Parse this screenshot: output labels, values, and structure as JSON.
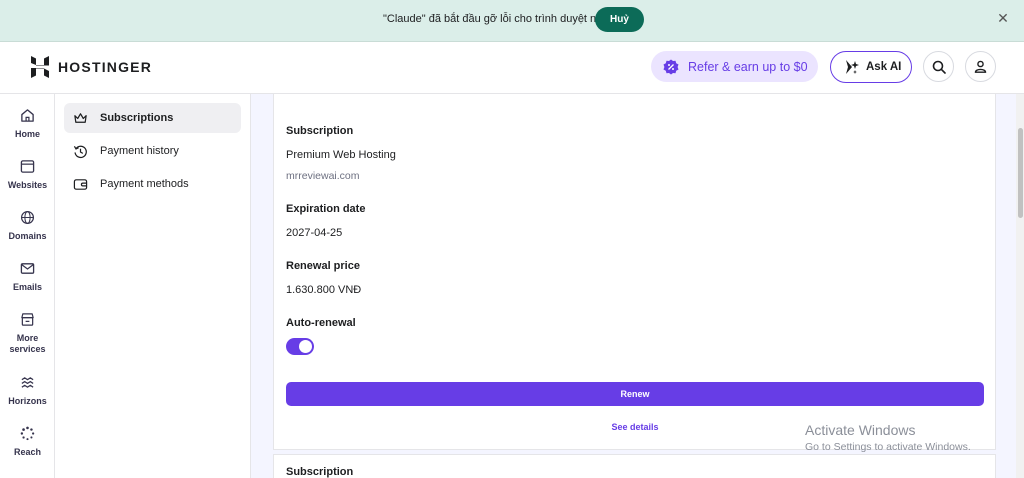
{
  "banner": {
    "message": "\"Claude\" đã bắt đầu gỡ lỗi cho trình duyệt này",
    "cancel_label": "Huỷ"
  },
  "header": {
    "brand": "HOSTINGER",
    "refer_label": "Refer & earn up to $0",
    "ask_ai_label": "Ask AI"
  },
  "rail": {
    "items": [
      {
        "label": "Home",
        "icon": "home-icon"
      },
      {
        "label": "Websites",
        "icon": "browser-window-icon"
      },
      {
        "label": "Domains",
        "icon": "globe-icon"
      },
      {
        "label": "Emails",
        "icon": "mail-icon"
      },
      {
        "label": "More services",
        "icon": "store-icon"
      },
      {
        "label": "Horizons",
        "icon": "waves-icon"
      },
      {
        "label": "Reach",
        "icon": "spinner-icon"
      }
    ]
  },
  "subnav": {
    "items": [
      {
        "label": "Subscriptions",
        "icon": "crown-icon",
        "active": true
      },
      {
        "label": "Payment history",
        "icon": "history-icon",
        "active": false
      },
      {
        "label": "Payment methods",
        "icon": "wallet-icon",
        "active": false
      }
    ]
  },
  "subscription": {
    "section_label": "Subscription",
    "plan": "Premium Web Hosting",
    "domain": "mrreviewai.com",
    "expiration_label": "Expiration date",
    "expiration_value": "2027-04-25",
    "renewal_label": "Renewal price",
    "renewal_value": "1.630.800 VNĐ",
    "auto_renewal_label": "Auto-renewal",
    "auto_renewal_on": true,
    "renew_button": "Renew",
    "see_details": "See details"
  },
  "next_card": {
    "section_label": "Subscription"
  },
  "watermark": {
    "title": "Activate Windows",
    "subtitle": "Go to Settings to activate Windows."
  },
  "colors": {
    "accent": "#673de6",
    "banner_bg": "#dbeee9",
    "banner_button": "#0c6b58",
    "main_bg": "#f4f5ff"
  }
}
